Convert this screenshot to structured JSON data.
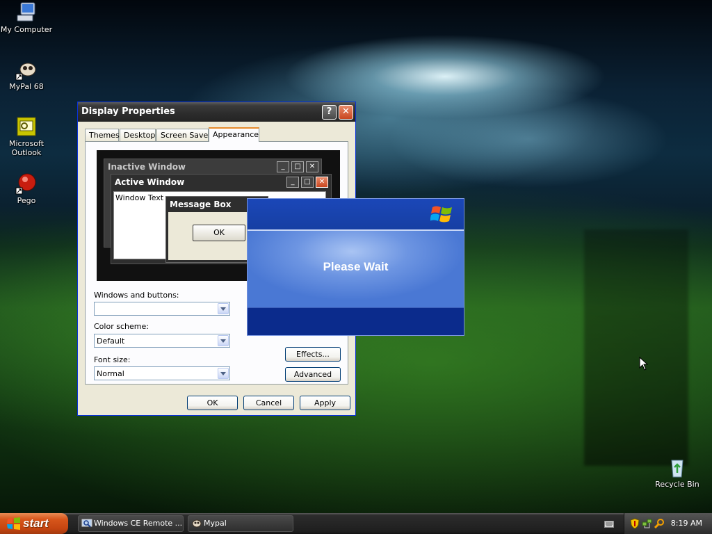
{
  "desktop": {
    "icons": [
      {
        "label": "My Computer",
        "icon": "my-computer-icon"
      },
      {
        "label": "MyPal 68",
        "icon": "mypal-icon"
      },
      {
        "label": "Microsoft Outlook",
        "icon": "outlook-icon"
      },
      {
        "label": "Pego",
        "icon": "pego-icon"
      },
      {
        "label": "Recycle Bin",
        "icon": "recycle-bin-icon"
      }
    ]
  },
  "window": {
    "title": "Display Properties",
    "help_label": "?",
    "close_label": "✕",
    "tabs": [
      {
        "label": "Themes"
      },
      {
        "label": "Desktop"
      },
      {
        "label": "Screen Saver"
      },
      {
        "label": "Appearance",
        "active": true
      }
    ],
    "preview": {
      "inactive_title": "Inactive Window",
      "active_title": "Active Window",
      "window_text": "Window Text",
      "message_box_title": "Message Box",
      "ok_label": "OK"
    },
    "fields": {
      "windows_buttons_label": "Windows and buttons:",
      "windows_buttons_value": "",
      "color_scheme_label": "Color scheme:",
      "color_scheme_value": "Default",
      "font_size_label": "Font size:",
      "font_size_value": "Normal"
    },
    "buttons": {
      "effects": "Effects...",
      "advanced": "Advanced",
      "ok": "OK",
      "cancel": "Cancel",
      "apply": "Apply"
    }
  },
  "wait_dialog": {
    "message": "Please Wait"
  },
  "taskbar": {
    "start_label": "start",
    "tasks": [
      {
        "label": "Windows CE Remote ...",
        "icon": "remote-icon"
      },
      {
        "label": "Mypal",
        "icon": "mypal-icon"
      }
    ],
    "clock": "8:19 AM"
  }
}
